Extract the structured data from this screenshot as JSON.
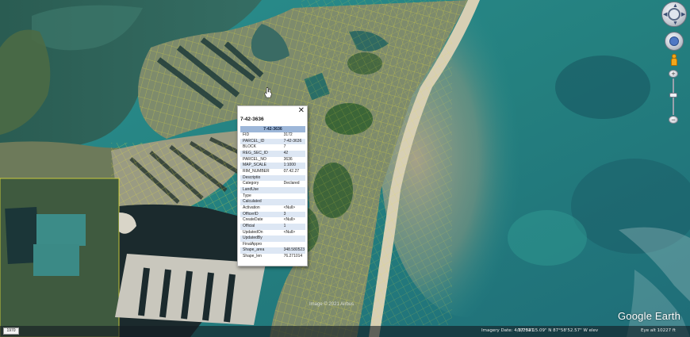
{
  "balloon": {
    "title": "7-42-3636",
    "table_header": "7-42-3636",
    "close_icon": "close-icon",
    "rows": [
      {
        "k": "FID",
        "v": "3172"
      },
      {
        "k": "PARCEL_ID",
        "v": "7-42-3636"
      },
      {
        "k": "BLOCK",
        "v": "7"
      },
      {
        "k": "REG_SEC_ID",
        "v": "42"
      },
      {
        "k": "PARCEL_NO",
        "v": "3636"
      },
      {
        "k": "MAP_SCALE",
        "v": "1:1000"
      },
      {
        "k": "RIM_NUMBER",
        "v": "07.42.27"
      },
      {
        "k": "Descriptio",
        "v": ""
      },
      {
        "k": "Category",
        "v": "Declared"
      },
      {
        "k": "LandUse",
        "v": ""
      },
      {
        "k": "Type",
        "v": ""
      },
      {
        "k": "Calculated",
        "v": ""
      },
      {
        "k": "Activation",
        "v": "<Null>"
      },
      {
        "k": "OfficerID",
        "v": "3"
      },
      {
        "k": "CreateDate",
        "v": "<Null>"
      },
      {
        "k": "Official",
        "v": "1"
      },
      {
        "k": "UpdatedOn",
        "v": "<Null>"
      },
      {
        "k": "UpdatedBy",
        "v": ""
      },
      {
        "k": "FinalAppro",
        "v": ""
      },
      {
        "k": "Shape_area",
        "v": "348.580523"
      },
      {
        "k": "Shape_len",
        "v": "76.271014"
      }
    ]
  },
  "status_bar": {
    "scale_label": "1970",
    "imagery_date": "Imagery Date: 4/8/2021",
    "coordinates": "17°54'15.09\" N   87°58'52.57\" W   elev",
    "eye_alt": "Eye alt  10227 ft"
  },
  "map": {
    "copyright": "Image © 2021 Airbus",
    "brand": "Google Earth"
  },
  "controls": {
    "look_icon": "look-joystick-icon",
    "move_icon": "move-joystick-icon",
    "pegman_icon": "pegman-icon",
    "zoom_in": "+",
    "zoom_out": "−",
    "zoom_level": 0.45
  },
  "colors": {
    "parcel_line": "#e9e33a",
    "water_shallow": "#2e8f8c",
    "water_deep": "#1e5e6b",
    "balloon_header": "#9db7d9"
  }
}
